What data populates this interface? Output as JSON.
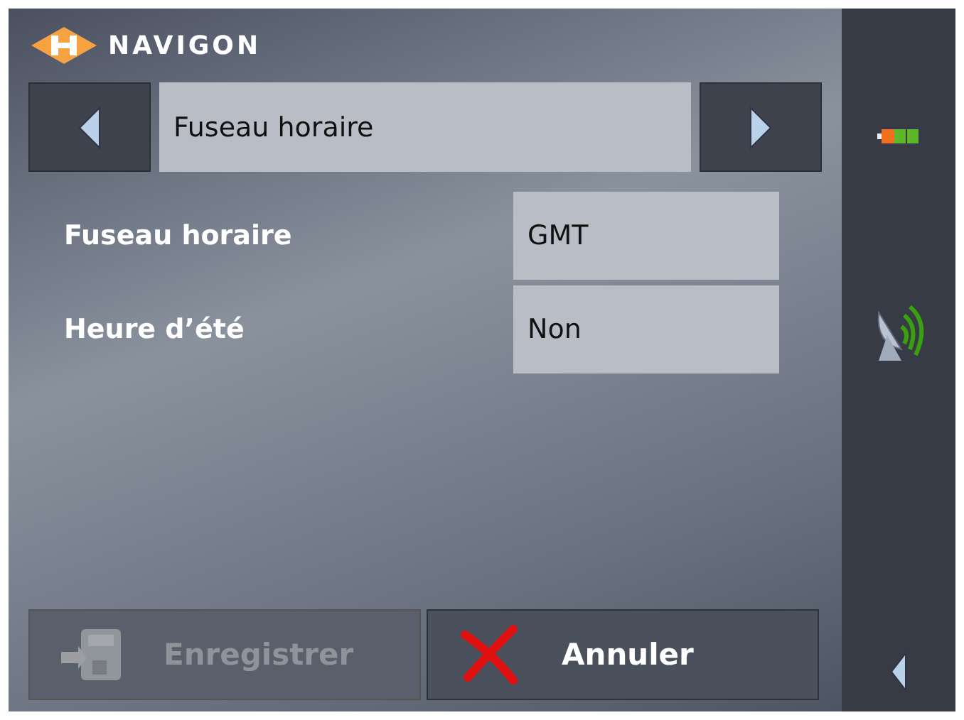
{
  "brand": "NAVIGON",
  "selector": {
    "label": "Fuseau horaire"
  },
  "settings": [
    {
      "label": "Fuseau horaire",
      "value": "GMT"
    },
    {
      "label": "Heure d’été",
      "value": "Non"
    }
  ],
  "buttons": [
    {
      "kind": "save",
      "label": "Enregistrer",
      "disabled": true
    },
    {
      "kind": "cancel",
      "label": "Annuler",
      "disabled": false
    }
  ]
}
